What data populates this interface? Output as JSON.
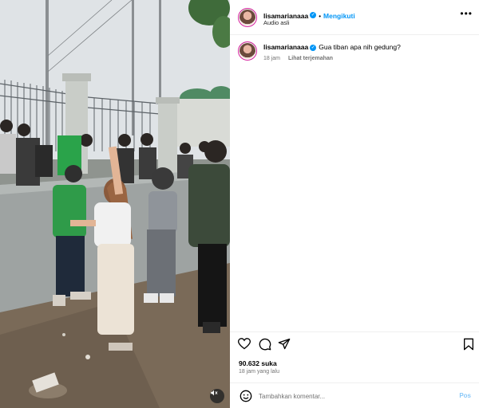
{
  "post": {
    "username": "lisamarianaaa",
    "follow_label": "Mengikuti",
    "separator": "•",
    "audio": "Audio asli",
    "more_label": "•••"
  },
  "caption": {
    "username": "lisamarianaaa",
    "text": "Gua tiban apa nih gedung?",
    "age": "18 jam",
    "translate_label": "Lihat terjemahan"
  },
  "stats": {
    "likes": "90.632 suka",
    "time": "18 jam yang lalu"
  },
  "comment": {
    "placeholder": "Tambahkan komentar...",
    "post_label": "Pos"
  },
  "icons": {
    "like": "heart-icon",
    "comment": "comment-icon",
    "share": "send-icon",
    "save": "bookmark-icon",
    "emoji": "emoji-icon",
    "mute": "speaker-icon"
  },
  "colors": {
    "accent": "#0095f6",
    "post_disabled": "#8ac8f8",
    "muted_text": "#737373"
  }
}
